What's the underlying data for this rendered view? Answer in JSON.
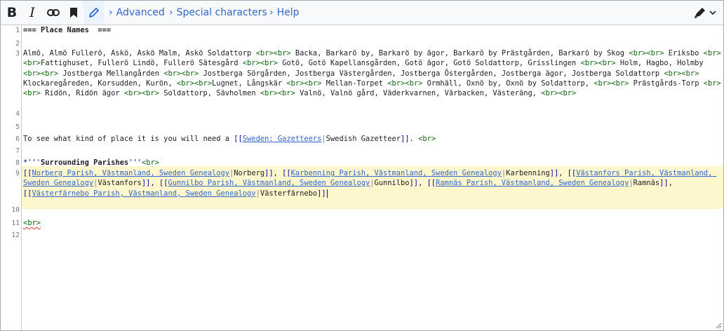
{
  "toolbar": {
    "bold_label": "B",
    "italic_label": "I",
    "link_icon": "link-icon",
    "save_icon": "bookmark-icon",
    "pen_icon": "pencil-icon",
    "menus": [
      "Advanced",
      "Special characters",
      "Help"
    ],
    "edit_mode_icon": "highlighter-icon"
  },
  "editor": {
    "line_numbers": [
      "1",
      "2",
      "3",
      "4",
      "5",
      "6",
      "7",
      "8",
      "9",
      "10",
      "11",
      "12"
    ],
    "line1": "=== Place Names  ===",
    "line3": "Almö, Almö Fullerö, Askö, Askö Malm, Askö Soldattorp <br><br> Backa, Barkarö by, Barkarö by ägor, Barkarö by Prästgården, Barkarö by Skog <br><br> Eriksbo <br><br>Fattighuset, Fullerö Lindö, Fullerö Sätesgård <br><br> Gotö, Gotö Kapellansgården, Gotö ägor, Gotö Soldattorp, Grisslingen <br><br> Holm, Hagbo, Holmby <br><br> Jostberga Mellangården <br><br> Jostberga Sörgården, Jostberga Västergården, Jostberga Östergården, Jostberga ägor, Jostberga Soldattorp <br><br> Klockaregåreden, Korsudden, Kurön, <br><br>Lugnet, Långskär <br><br> Mellan-Torpet <br><br> Ormhäll, Oxnö by, Oxnö by Soldattorp, <br><br> Prästgårds-Torp <br><br> Ridön, Ridön ägor <br><br> Soldattorp, Sävholmen <br><br> Valnö, Valnö gård, Väderkvarnen, Värbacken, Västeräng, <br><br>",
    "line6": {
      "before": "To see what kind of place it is you will need a ",
      "open": "[[",
      "target": "Sweden: Gazetteers",
      "pipe": "|",
      "label": "Swedish Gazetteer",
      "close": "]]",
      "after": ". ",
      "br": "<br>"
    },
    "line8": {
      "prefix": "*",
      "ticks_open": "'''",
      "bold_text": "Surrounding Parishes",
      "ticks_close": "'''",
      "br": "<br>"
    },
    "line9_links": [
      {
        "target": "Norberg Parish, Västmanland, Sweden Genealogy",
        "label": "Norberg"
      },
      {
        "target": "Karbenning Parish, Västmanland, Sweden Genealogy",
        "label": "Karbenning"
      },
      {
        "target": "Västanfors Parish, Västmanland, Sweden Genealogy",
        "label": "Västanfors"
      },
      {
        "target": "Gunnilbo Parish, Västmanland, Sweden Genealogy",
        "label": "Gunnilbo"
      },
      {
        "target": "Ramnäs Parish, Västmanland, Sweden Genealogy",
        "label": "Ramnäs"
      },
      {
        "target": "Västerfärnebo Parish, Västmanland, Sweden Genealogy",
        "label": "Västerfärnebo"
      }
    ],
    "line9_sep": ", ",
    "line11": "<br>"
  }
}
